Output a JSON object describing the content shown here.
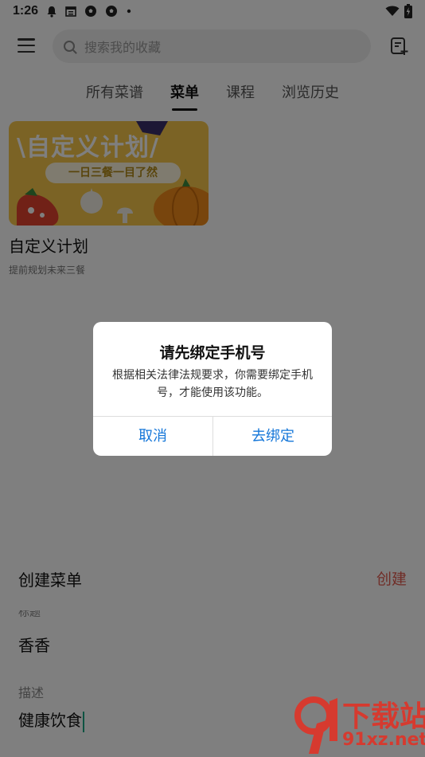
{
  "status_bar": {
    "time": "1:26",
    "icons": [
      "bell-icon",
      "calendar-icon",
      "soccer-icon",
      "soccer-icon",
      "dot-icon"
    ],
    "right_icons": [
      "wifi-icon",
      "battery-icon"
    ]
  },
  "header": {
    "search": {
      "placeholder": "搜索我的收藏"
    }
  },
  "tabs": [
    {
      "label": "所有菜谱",
      "active": false
    },
    {
      "label": "菜单",
      "active": true
    },
    {
      "label": "课程",
      "active": false
    },
    {
      "label": "浏览历史",
      "active": false
    }
  ],
  "card": {
    "banner_title": "\\自定义计划/",
    "banner_subtitle": "一日三餐一目了然",
    "title": "自定义计划",
    "subtitle": "提前规划未来三餐"
  },
  "sheet": {
    "title": "创建菜单",
    "create_label": "创建",
    "title_field_label": "标题",
    "title_value": "香香",
    "description_label": "描述",
    "description_value": "健康饮食"
  },
  "dialog": {
    "title": "请先绑定手机号",
    "message": "根据相关法律法规要求，你需要绑定手机号，才能使用该功能。",
    "cancel_label": "取消",
    "confirm_label": "去绑定"
  },
  "watermark": {
    "brand_top": "下载站",
    "brand_bottom": "91xz.net"
  },
  "colors": {
    "accent": "#1677d9",
    "create": "#e05a4e",
    "banner": "#f7c64a",
    "caret": "#1ba784"
  }
}
